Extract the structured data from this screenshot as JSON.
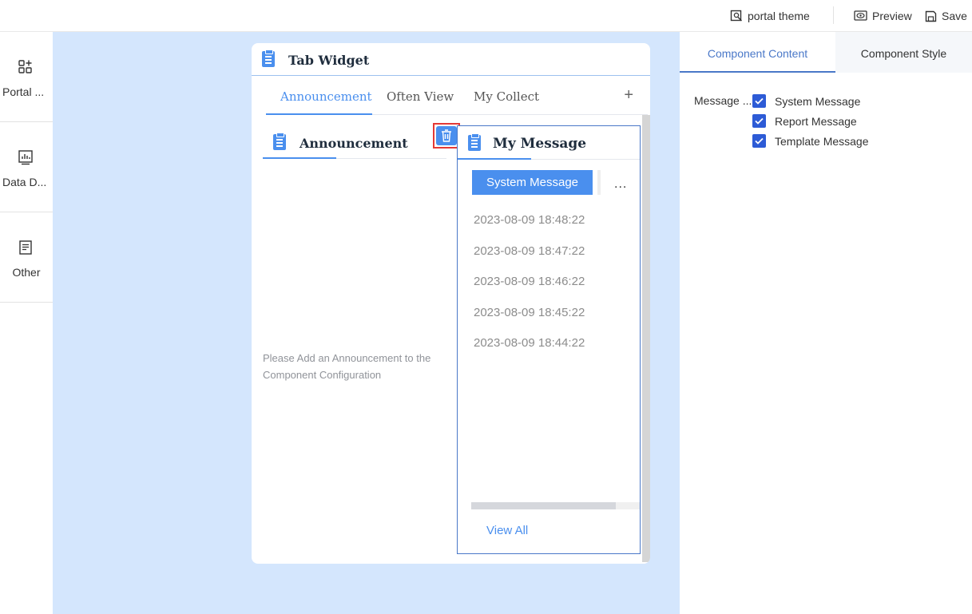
{
  "topbar": {
    "theme_label": "portal theme",
    "preview_label": "Preview",
    "save_label": "Save"
  },
  "sidebar": {
    "items": [
      {
        "label": "Portal ...",
        "icon": "add-component-icon"
      },
      {
        "label": "Data D...",
        "icon": "bar-chart-icon"
      },
      {
        "label": "Other",
        "icon": "document-icon"
      }
    ]
  },
  "widget": {
    "title": "Tab Widget",
    "tabs": [
      "Announcement",
      "Often View",
      "My Collect"
    ],
    "add_label": "+",
    "left_panel": {
      "title": "Announcement",
      "empty_note": "Please Add an Announcement to the Component Configuration"
    },
    "right_panel": {
      "title": "My Message",
      "category_button": "System Message",
      "more_label": "...",
      "messages": [
        "2023-08-09 18:48:22",
        "2023-08-09 18:47:22",
        "2023-08-09 18:46:22",
        "2023-08-09 18:45:22",
        "2023-08-09 18:44:22"
      ],
      "view_all": "View All"
    }
  },
  "config_panel": {
    "tabs": [
      "Component Content",
      "Component Style"
    ],
    "field_label": "Message ...",
    "options": [
      {
        "label": "System Message",
        "checked": true
      },
      {
        "label": "Report Message",
        "checked": true
      },
      {
        "label": "Template Message",
        "checked": true
      }
    ]
  },
  "colors": {
    "accent": "#4a8fee",
    "canvas": "#d4e6fd",
    "checkbox": "#2d5bd6",
    "highlight": "#e53935"
  }
}
